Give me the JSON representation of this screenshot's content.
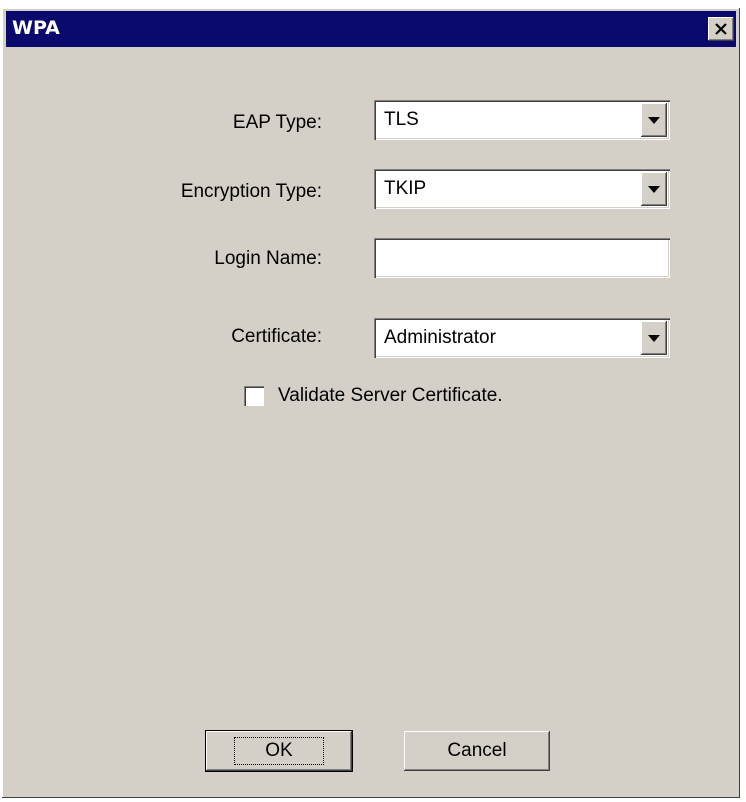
{
  "window": {
    "title": "WPA",
    "close_icon": "close-icon"
  },
  "form": {
    "eap_type": {
      "label": "EAP Type:",
      "value": "TLS"
    },
    "encryption_type": {
      "label": "Encryption Type:",
      "value": "TKIP"
    },
    "login_name": {
      "label": "Login Name:",
      "value": ""
    },
    "certificate": {
      "label": "Certificate:",
      "value": "Administrator"
    },
    "validate_server_certificate": {
      "label": "Validate Server Certificate.",
      "checked": false
    }
  },
  "buttons": {
    "ok_label": "OK",
    "cancel_label": "Cancel"
  },
  "colors": {
    "titlebar": "#0a0a6e",
    "dialog_face": "#d4d0c8"
  }
}
